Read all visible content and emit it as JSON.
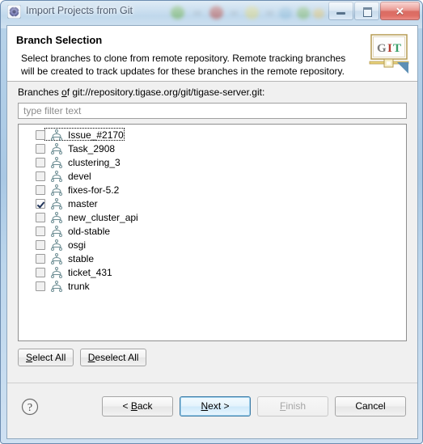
{
  "window": {
    "title": "Import Projects from Git",
    "icon": "gear-icon",
    "controls": {
      "minimize": "Minimize",
      "maximize": "Maximize",
      "close": "Close",
      "close_glyph": "✕"
    }
  },
  "banner": {
    "title": "Branch Selection",
    "description": "Select branches to clone from remote repository. Remote tracking branches will be created to track updates for these branches in the remote repository.",
    "logo_text": "GIT",
    "logo_letters": [
      "G",
      "I",
      "T"
    ]
  },
  "body": {
    "branches_label_prefix": "Branches ",
    "branches_label_mnemonic": "o",
    "branches_label_suffix": "f git://repository.tigase.org/git/tigase-server.git:",
    "filter": {
      "value": "",
      "placeholder": "type filter text"
    },
    "branches": [
      {
        "label": "Issue_#2170",
        "checked": false,
        "focused": true
      },
      {
        "label": "Task_2908",
        "checked": false,
        "focused": false
      },
      {
        "label": "clustering_3",
        "checked": false,
        "focused": false
      },
      {
        "label": "devel",
        "checked": false,
        "focused": false
      },
      {
        "label": "fixes-for-5.2",
        "checked": false,
        "focused": false
      },
      {
        "label": "master",
        "checked": true,
        "focused": false
      },
      {
        "label": "new_cluster_api",
        "checked": false,
        "focused": false
      },
      {
        "label": "old-stable",
        "checked": false,
        "focused": false
      },
      {
        "label": "osgi",
        "checked": false,
        "focused": false
      },
      {
        "label": "stable",
        "checked": false,
        "focused": false
      },
      {
        "label": "ticket_431",
        "checked": false,
        "focused": false
      },
      {
        "label": "trunk",
        "checked": false,
        "focused": false
      }
    ],
    "select_all": {
      "prefix": "",
      "mnemonic": "S",
      "suffix": "elect All"
    },
    "deselect_all": {
      "prefix": "",
      "mnemonic": "D",
      "suffix": "eselect All"
    }
  },
  "footer": {
    "help": "?",
    "back": {
      "prefix": "< ",
      "mnemonic": "B",
      "suffix": "ack",
      "enabled": true,
      "default": false
    },
    "next": {
      "prefix": "",
      "mnemonic": "N",
      "suffix": "ext >",
      "enabled": true,
      "default": true
    },
    "finish": {
      "prefix": "",
      "mnemonic": "F",
      "suffix": "inish",
      "enabled": false,
      "default": false
    },
    "cancel": {
      "prefix": "",
      "mnemonic": "",
      "suffix": "Cancel",
      "enabled": true,
      "default": false
    }
  },
  "colors": {
    "titlebar": "#b9d4ea",
    "close_button": "#cd3c30",
    "dialog_bg": "#f0f0f0",
    "banner_bg": "#ffffff",
    "default_button_border": "#3d7ca6",
    "branch_icon": "#6f8f95"
  }
}
